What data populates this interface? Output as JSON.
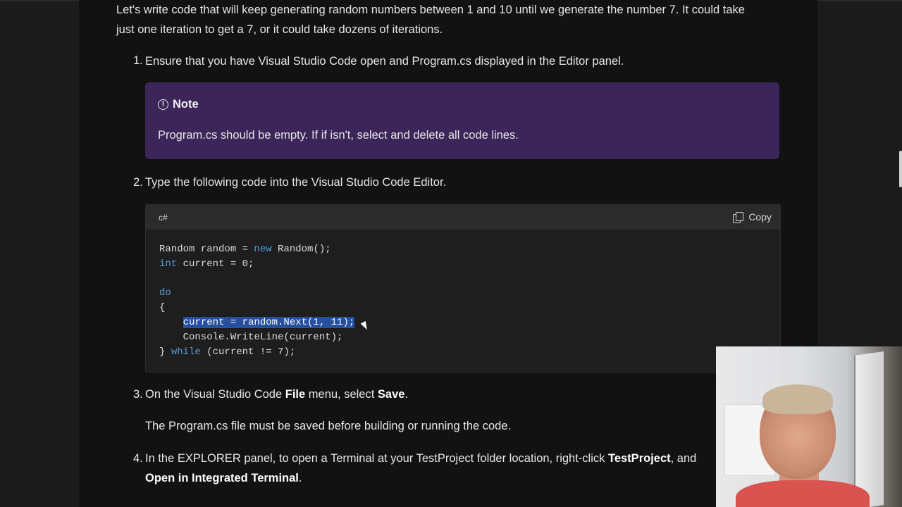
{
  "intro": "Let's write code that will keep generating random numbers between 1 and 10 until we generate the number 7. It could take just one iteration to get a 7, or it could take dozens of iterations.",
  "steps": [
    {
      "num": "1.",
      "text": "Ensure that you have Visual Studio Code open and Program.cs displayed in the Editor panel."
    },
    {
      "num": "2.",
      "text": "Type the following code into the Visual Studio Code Editor."
    },
    {
      "num": "3.",
      "text_before": "On the Visual Studio Code ",
      "bold1": "File",
      "text_mid": " menu, select ",
      "bold2": "Save",
      "text_after": ".",
      "sub": "The Program.cs file must be saved before building or running the code."
    },
    {
      "num": "4.",
      "text_before": "In the EXPLORER panel, to open a Terminal at your TestProject folder location, right-click ",
      "bold1": "TestProject",
      "text_mid": ", and",
      "line2_bold": "Open in Integrated Terminal",
      "line2_after": "."
    }
  ],
  "note": {
    "title": "Note",
    "icon": "info-circle-icon",
    "body": "Program.cs should be empty. If if isn't, select and delete all code lines."
  },
  "code": {
    "language": "c#",
    "copy_label": "Copy",
    "lines": [
      [
        "Random random = ",
        "new",
        " Random();"
      ],
      [
        "int",
        " current = 0;"
      ],
      [
        ""
      ],
      [
        "do"
      ],
      [
        "{"
      ],
      [
        "    ",
        "current = random.Next(1, 11);"
      ],
      [
        "    Console.WriteLine(current);"
      ],
      [
        "} ",
        "while",
        " (current != 7);"
      ]
    ]
  },
  "colors": {
    "background": "#121212",
    "note_background": "#3b2559",
    "keyword": "#569cd6",
    "selection": "#264f9e"
  }
}
